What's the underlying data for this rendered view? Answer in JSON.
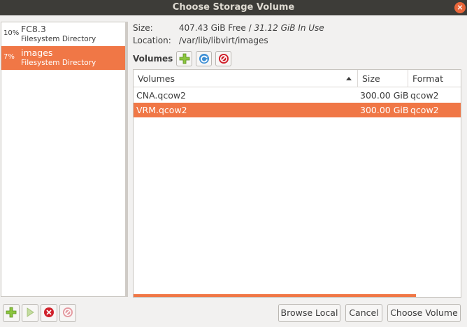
{
  "window": {
    "title": "Choose Storage Volume",
    "close_glyph": "×"
  },
  "pools": [
    {
      "percent": "10%",
      "name": "FC8.3",
      "type": "Filesystem Directory",
      "selected": false
    },
    {
      "percent": "7%",
      "name": "images",
      "type": "Filesystem Directory",
      "selected": true
    }
  ],
  "info": {
    "size_label": "Size:",
    "size_free": "407.43 GiB Free / ",
    "size_in_use": "31.12 GiB In Use",
    "location_label": "Location:",
    "location_value": "/var/lib/libvirt/images"
  },
  "volumes_toolbar": {
    "label": "Volumes",
    "add_icon": "add-volume-icon",
    "refresh_icon": "refresh-icon",
    "delete_icon": "delete-icon"
  },
  "volume_table": {
    "columns": [
      "Volumes",
      "Size",
      "Format"
    ],
    "sort_column": "Volumes",
    "rows": [
      {
        "name": "CNA.qcow2",
        "size": "300.00 GiB",
        "format": "qcow2",
        "selected": false
      },
      {
        "name": "VRM.qcow2",
        "size": "300.00 GiB",
        "format": "qcow2",
        "selected": true
      }
    ]
  },
  "bottom_buttons": {
    "browse_local": "Browse Local",
    "cancel": "Cancel",
    "choose_volume": "Choose Volume"
  },
  "colors": {
    "accent": "#f07746",
    "titlebar": "#3d3c38",
    "background": "#f2f1f0"
  }
}
